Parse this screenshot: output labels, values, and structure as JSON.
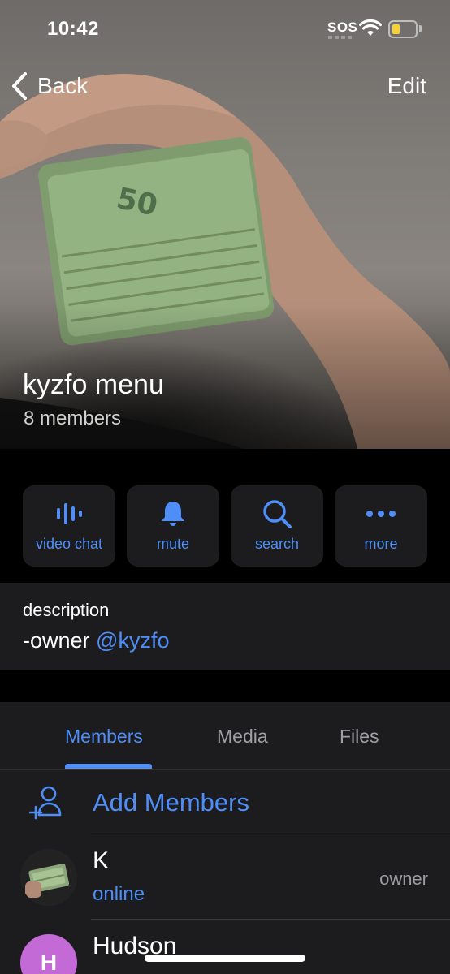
{
  "status_bar": {
    "time": "10:42",
    "sos": "SOS",
    "battery_level": 0.25
  },
  "nav": {
    "back_label": "Back",
    "edit_label": "Edit"
  },
  "group": {
    "title": "kyzfo menu",
    "subtitle": "8 members"
  },
  "actions": [
    {
      "label": "video chat",
      "icon": "voice-chat-icon"
    },
    {
      "label": "mute",
      "icon": "bell-icon"
    },
    {
      "label": "search",
      "icon": "search-icon"
    },
    {
      "label": "more",
      "icon": "more-dots-icon"
    }
  ],
  "description": {
    "label": "description",
    "text": "-owner ",
    "mention": "@kyzfo"
  },
  "tabs": [
    {
      "label": "Members",
      "active": true
    },
    {
      "label": "Media",
      "active": false
    },
    {
      "label": "Files",
      "active": false
    }
  ],
  "add_members": {
    "label": "Add Members",
    "icon": "add-person-icon"
  },
  "members": [
    {
      "name": "K",
      "status": "online",
      "role": "owner",
      "avatar": "photo"
    },
    {
      "name": "Hudson",
      "status": "",
      "role": "",
      "avatar_initial": "H",
      "avatar_color": "#c36ad6"
    }
  ],
  "colors": {
    "accent": "#4f8ef7",
    "panel": "#1c1c1e",
    "background": "#000000"
  }
}
